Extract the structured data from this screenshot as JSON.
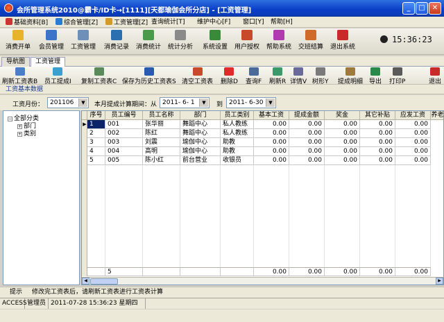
{
  "window": {
    "title": "会所管理系统2010@霸卡/ID卡→[1111][天都瑜伽会所分店] - [工资管理]",
    "btn_min": "_",
    "btn_max": "□",
    "btn_close": "✕"
  },
  "menu": [
    "基础资料[B]",
    "综合管理[Z]",
    "工资管理[Z]",
    "查询统计[T]",
    "维护中心[F]",
    "窗口[Y]",
    "帮助[H]"
  ],
  "toolbar1": [
    "消费开单",
    "会员管理",
    "工资管理",
    "消费记录",
    "消费统计",
    "统计分析",
    "系统设置",
    "用户授权",
    "帮助系统",
    "交班结算",
    "退出系统"
  ],
  "clock": "15:36:23",
  "tabs": [
    "导航图",
    "工资管理"
  ],
  "toolbar2": [
    "刷新工资表B",
    "员工提成I",
    "复制工资表C",
    "保存为历史工资表S",
    "清空工资表",
    "删除D",
    "查询F",
    "刷新R",
    "详情V",
    "树形Y",
    "提成明细",
    "导出",
    "打印P",
    "退出"
  ],
  "section_title": "工资基本数据",
  "filter": {
    "month_label": "工资月份：",
    "month_value": "201106",
    "range_label": "本月提成计算期间：从",
    "from_value": "2011- 6- 1",
    "to_label": "到",
    "to_value": "2011- 6-30"
  },
  "tree": {
    "root": "全部分类",
    "children": [
      "部门",
      "类别"
    ],
    "root_toggle": "−",
    "child_toggle": "+"
  },
  "grid": {
    "columns": [
      "序号",
      "员工编号",
      "员工名称",
      "部门",
      "员工类别",
      "基本工资",
      "提成金额",
      "奖金",
      "其它补贴",
      "应发工资",
      "养老"
    ],
    "rows": [
      [
        "1",
        "001",
        "张华丽",
        "舞蹈中心",
        "私人教练",
        "0.00",
        "0.00",
        "0.00",
        "0.00",
        "0.00"
      ],
      [
        "2",
        "002",
        "陈红",
        "舞蹈中心",
        "私人教练",
        "0.00",
        "0.00",
        "0.00",
        "0.00",
        "0.00"
      ],
      [
        "3",
        "003",
        "刘震",
        "瑜伽中心",
        "助教",
        "0.00",
        "0.00",
        "0.00",
        "0.00",
        "0.00"
      ],
      [
        "4",
        "004",
        "高明",
        "瑜伽中心",
        "助教",
        "0.00",
        "0.00",
        "0.00",
        "0.00",
        "0.00"
      ],
      [
        "5",
        "005",
        "陈小红",
        "前台营业",
        "收银员",
        "0.00",
        "0.00",
        "0.00",
        "0.00",
        "0.00"
      ]
    ],
    "row_pointer": "▶",
    "footer": [
      "5",
      "",
      "",
      "",
      "",
      "0.00",
      "0.00",
      "0.00",
      "0.00",
      "0.00"
    ],
    "scroll_left": "◀",
    "scroll_right": "▶"
  },
  "tip": {
    "label": "提示",
    "text": "修改完工资表后，请刷新工资表进行工资表计算"
  },
  "status": [
    "ACCESS",
    "管理员",
    "2011-07-28 15:36:23 星期四"
  ]
}
